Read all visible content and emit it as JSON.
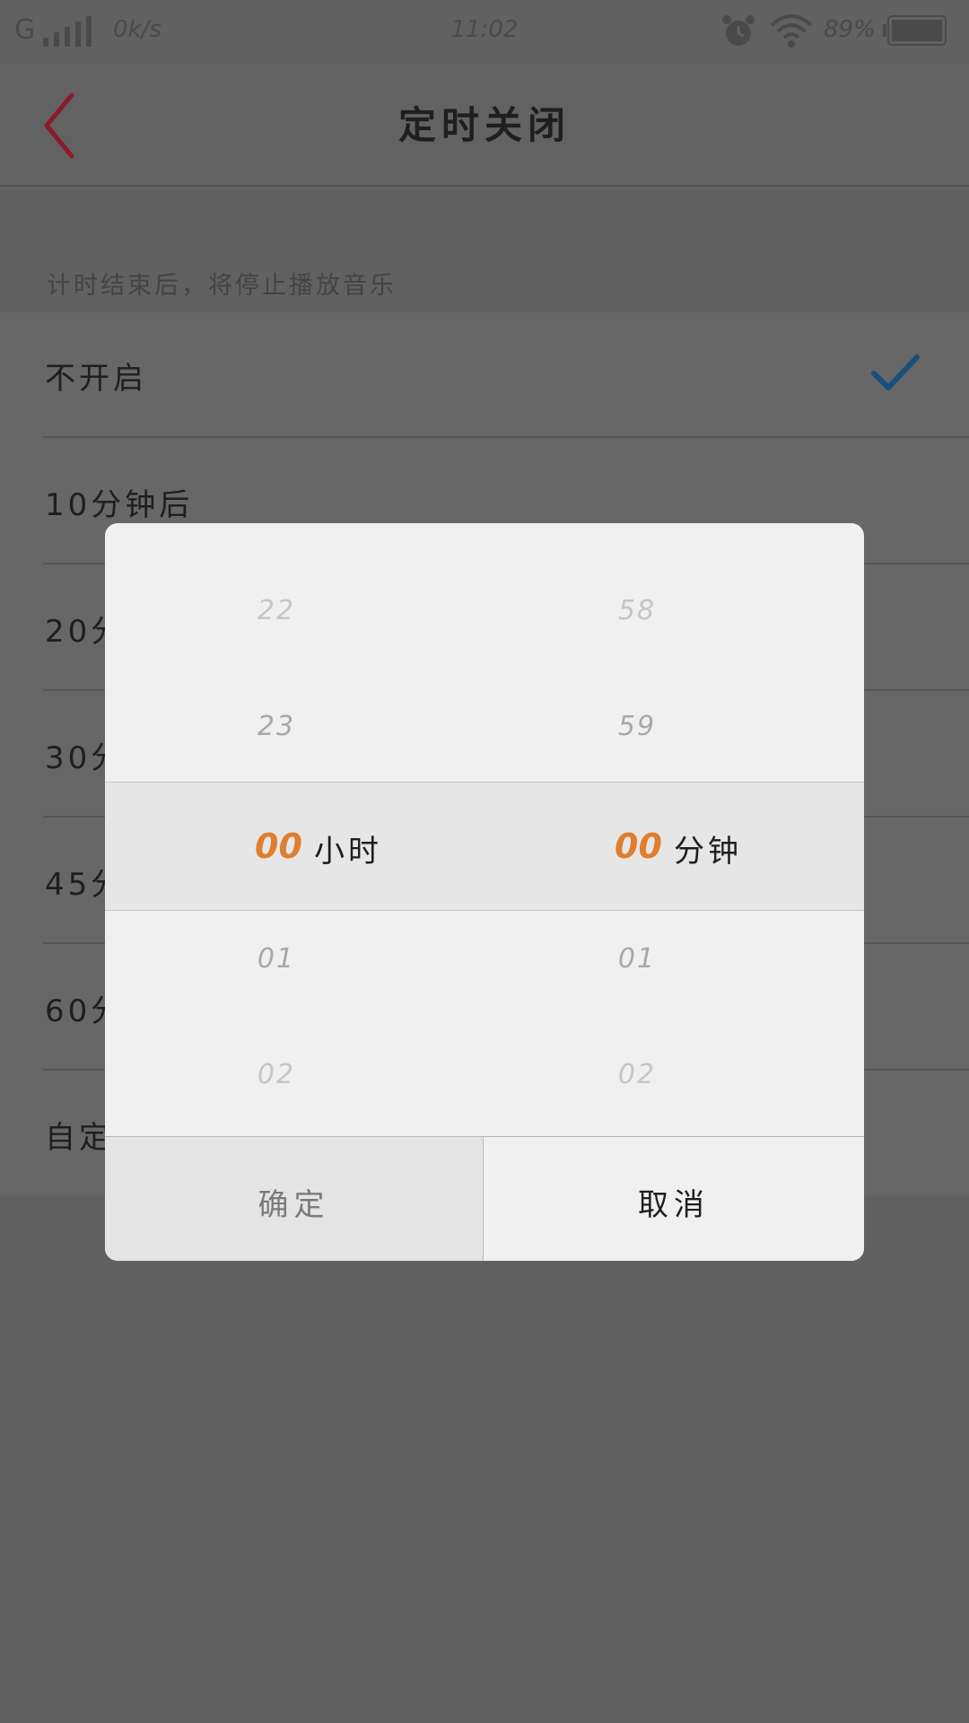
{
  "status_bar": {
    "carrier": "G",
    "speed": "0k/s",
    "time": "11:02",
    "battery_pct": "89%"
  },
  "nav": {
    "title": "定时关闭",
    "back_icon": "chevron-left-icon",
    "back_color": "#8b1a2b"
  },
  "hint": "计时结束后，将停止播放音乐",
  "options": [
    {
      "label": "不开启",
      "selected": true
    },
    {
      "label": "10分钟后"
    },
    {
      "label": "20分"
    },
    {
      "label": "30分"
    },
    {
      "label": "45分"
    },
    {
      "label": "60分"
    },
    {
      "label": "自定"
    }
  ],
  "check_color": "#1a4f7a",
  "picker": {
    "hours": {
      "far_above": "22",
      "near_above": "23",
      "selected": "00",
      "unit": "小时",
      "near_below": "01",
      "far_below": "02"
    },
    "minutes": {
      "far_above": "58",
      "near_above": "59",
      "selected": "00",
      "unit": "分钟",
      "near_below": "01",
      "far_below": "02"
    },
    "accent_color": "#e07e2f"
  },
  "buttons": {
    "confirm": "确定",
    "cancel": "取消"
  }
}
